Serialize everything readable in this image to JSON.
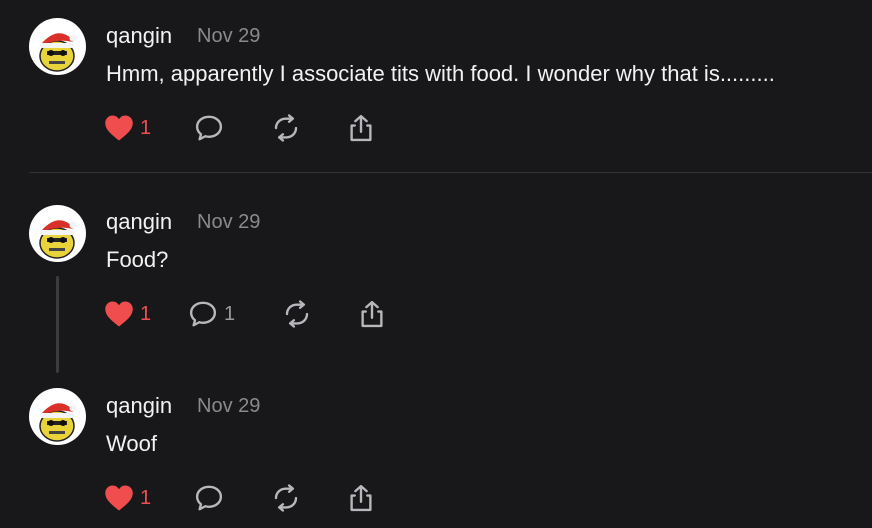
{
  "colors": {
    "background": "#18181a",
    "like": "#f04e4e",
    "icon": "#b8b8bc",
    "divider": "#333336"
  },
  "posts": [
    {
      "author": "qangin",
      "date": "Nov 29",
      "text": "Hmm, apparently I associate tits with food. I wonder why that is.........",
      "likes": "1",
      "replies": ""
    },
    {
      "author": "qangin",
      "date": "Nov 29",
      "text": "Food?",
      "likes": "1",
      "replies": "1"
    },
    {
      "author": "qangin",
      "date": "Nov 29",
      "text": "Woof",
      "likes": "1",
      "replies": ""
    }
  ],
  "icons": {
    "like": "heart-icon",
    "reply": "comment-icon",
    "repost": "repost-icon",
    "share": "share-icon"
  }
}
